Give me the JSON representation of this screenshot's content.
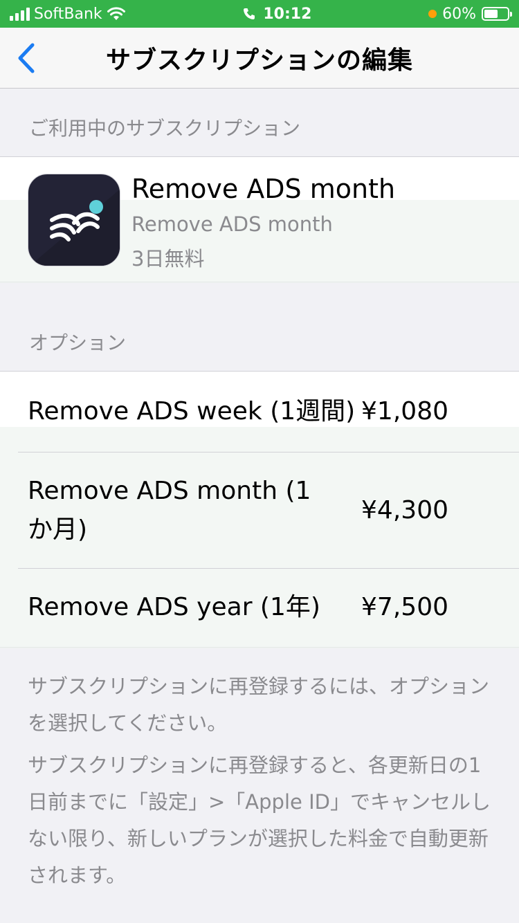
{
  "status_bar": {
    "carrier": "SoftBank",
    "time": "10:12",
    "battery": "60%",
    "battery_level": 0.6
  },
  "nav": {
    "title": "サブスクリプションの編集"
  },
  "current": {
    "section_label": "ご利用中のサブスクリプション",
    "title": "Remove ADS month",
    "subtitle": "Remove ADS month",
    "trial": "3日無料"
  },
  "options": {
    "section_label": "オプション",
    "items": [
      {
        "name": "Remove ADS week (1週間)",
        "price": "¥1,080"
      },
      {
        "name": "Remove ADS month (1か月)",
        "price": "¥4,300"
      },
      {
        "name": "Remove ADS year (1年)",
        "price": "¥7,500"
      }
    ]
  },
  "footer": {
    "note1": "サブスクリプションに再登録するには、オプションを選択してください。",
    "note2": "サブスクリプションに再登録すると、各更新日の1日前までに「設定」>「Apple ID」でキャンセルしない限り、新しいプランが選択した料金で自動更新されます。"
  },
  "colors": {
    "status_bar": "#35b34a",
    "accent": "#1b7cf2",
    "secondary_text": "#8a8a8e",
    "icon_dot": "#5fd0d9"
  }
}
